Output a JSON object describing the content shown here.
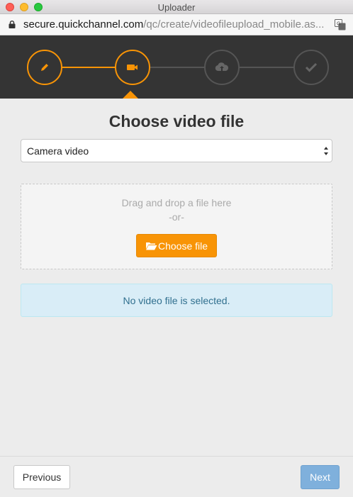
{
  "window": {
    "title": "Uploader"
  },
  "urlbar": {
    "host": "secure.quickchannel.com",
    "path": "/qc/create/videofileupload_mobile.as..."
  },
  "stepper": {
    "steps": [
      {
        "icon": "pencil-icon",
        "state": "done"
      },
      {
        "icon": "video-camera-icon",
        "state": "active"
      },
      {
        "icon": "cloud-upload-icon",
        "state": "pending"
      },
      {
        "icon": "checkmark-icon",
        "state": "pending"
      }
    ],
    "colors": {
      "accent": "#f89406",
      "inactive": "#555555",
      "background": "#343434"
    }
  },
  "main": {
    "heading": "Choose video file",
    "source_select": {
      "selected": "Camera video"
    },
    "dropzone": {
      "line1": "Drag and drop a file here",
      "line2": "-or-",
      "button_label": "Choose file"
    },
    "alert": {
      "message": "No video file is selected."
    }
  },
  "footer": {
    "previous_label": "Previous",
    "next_label": "Next"
  }
}
